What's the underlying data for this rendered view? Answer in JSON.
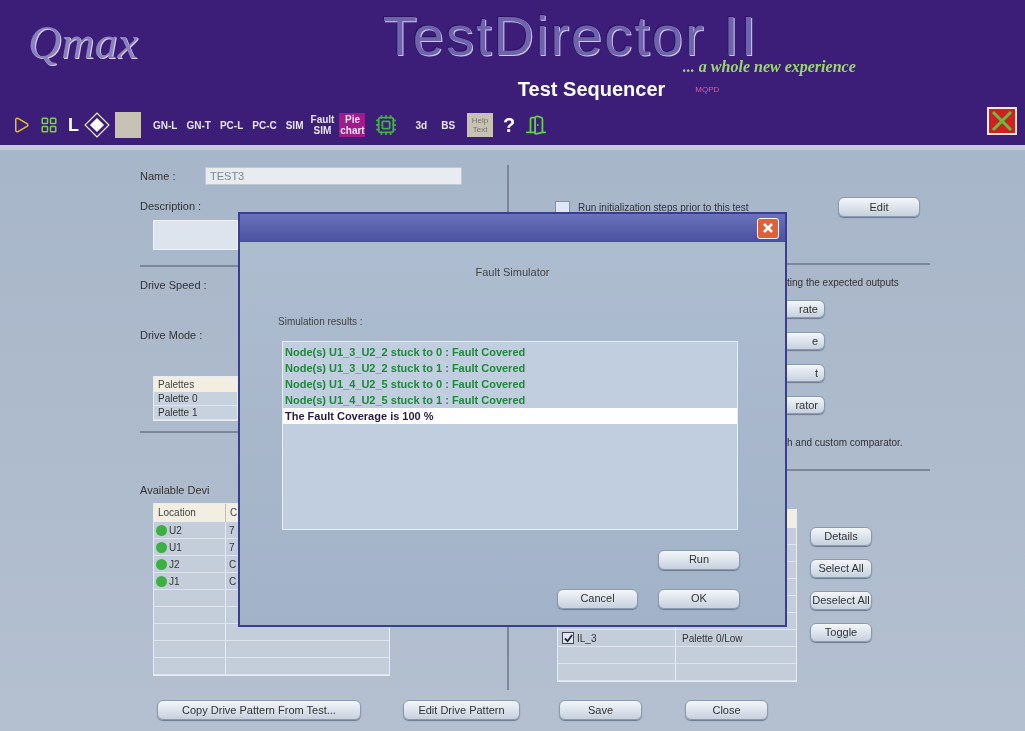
{
  "header": {
    "logo": "Qmax",
    "title": "TestDirector II",
    "tagline": "... a whole new experience",
    "subtitle": "Test Sequencer",
    "code": "MQPD"
  },
  "toolbar": {
    "letter": "L",
    "buttons": [
      {
        "label": "GN-L",
        "kind": "plain"
      },
      {
        "label": "GN-T",
        "kind": "plain"
      },
      {
        "label": "PC-L",
        "kind": "plain"
      },
      {
        "label": "PC-C",
        "kind": "plain"
      },
      {
        "label": "SIM",
        "kind": "plain"
      },
      {
        "label": "Fault SIM",
        "kind": "stacked"
      },
      {
        "label": "Pie chart",
        "kind": "highlight"
      }
    ],
    "buttons2": [
      {
        "label": "3d",
        "kind": "plain"
      },
      {
        "label": "BS",
        "kind": "plain"
      },
      {
        "label": "Help Text",
        "kind": "gray"
      }
    ],
    "help": "?"
  },
  "form": {
    "name_label": "Name :",
    "name_value": "TEST3",
    "name_disabled": true,
    "description_label": "Description :",
    "drive_speed_label": "Drive Speed :",
    "drive_mode_label": "Drive Mode :",
    "palettes": {
      "header": "Palettes",
      "rows": [
        "Palette 0",
        "Palette 1"
      ]
    },
    "devices_label": "Available Devi",
    "devices": {
      "columns": [
        "Location",
        "C"
      ],
      "rows": [
        {
          "cells": [
            "U2",
            "7"
          ],
          "color": "#3cb043"
        },
        {
          "cells": [
            "U1",
            "7"
          ],
          "color": "#3cb043"
        },
        {
          "cells": [
            "J2",
            "C"
          ],
          "color": "#3cb043"
        },
        {
          "cells": [
            "J1",
            "C"
          ],
          "color": "#3cb043"
        }
      ]
    },
    "run_init": {
      "label": "Run initialization steps prior to this test",
      "checked": false
    },
    "edit_button": "Edit",
    "expected_text": "ting the expected outputs",
    "partial_buttons": [
      "rate",
      "e",
      "t",
      "rator"
    ],
    "comparator_text": "h and custom comparator.",
    "selected_devices": {
      "rows": [
        {
          "cells": [
            "IL_3",
            "Palette 0/Low"
          ],
          "checked": true
        }
      ]
    },
    "side_buttons": [
      "Details",
      "Select All",
      "Deselect All",
      "Toggle"
    ],
    "bottom_buttons": [
      "Copy Drive Pattern From Test...",
      "Edit Drive Pattern",
      "Save",
      "Close"
    ]
  },
  "dialog": {
    "header": "Fault Simulator",
    "results_label": "Simulation results :",
    "results": [
      {
        "text": "Node(s) U1_3_U2_2 stuck to 0  : Fault Covered",
        "kind": "covered",
        "selected": false
      },
      {
        "text": "Node(s) U1_3_U2_2 stuck to 1  : Fault Covered",
        "kind": "covered",
        "selected": false
      },
      {
        "text": "Node(s) U1_4_U2_5 stuck to 0  : Fault Covered",
        "kind": "covered",
        "selected": false
      },
      {
        "text": "Node(s) U1_4_U2_5 stuck to 1  : Fault Covered",
        "kind": "covered",
        "selected": false
      },
      {
        "text": "The Fault Coverage is 100 %",
        "kind": "summary",
        "selected": true
      }
    ],
    "buttons": [
      "Run",
      "Cancel",
      "OK"
    ]
  }
}
